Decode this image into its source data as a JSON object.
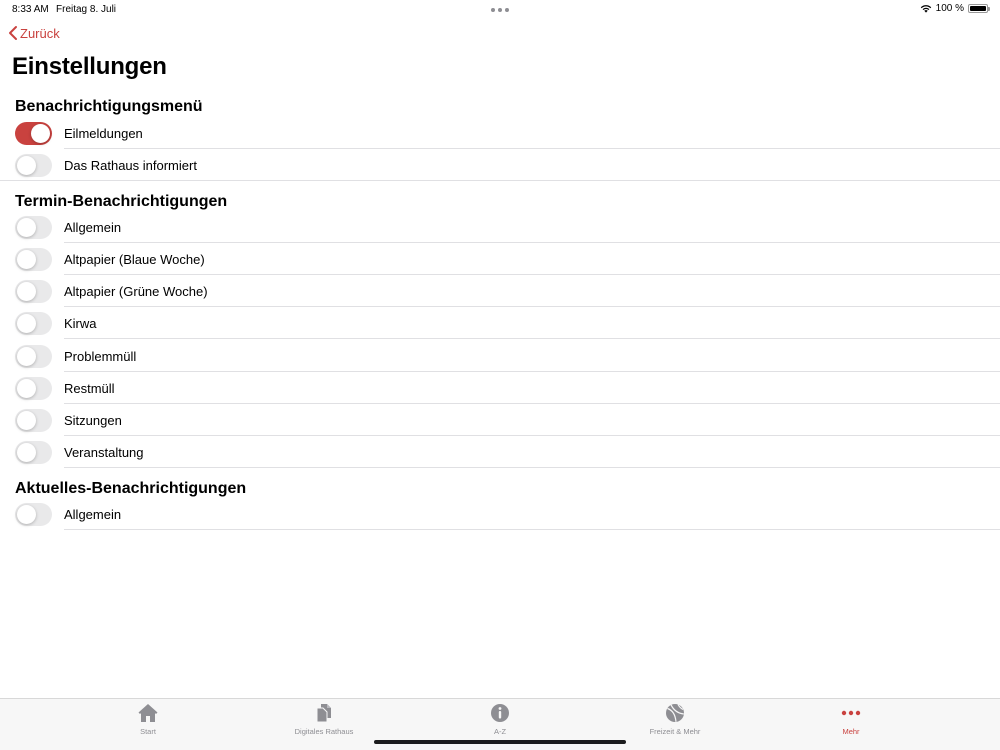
{
  "status_bar": {
    "time": "8:33 AM",
    "date": "Freitag 8. Juli",
    "battery_text": "100 %",
    "icons": [
      "wifi-icon",
      "battery-icon"
    ]
  },
  "nav": {
    "back_label": "Zurück",
    "title": "Einstellungen"
  },
  "accent_color": "#c9423f",
  "sections": [
    {
      "title": "Benachrichtigungsmenü",
      "items": [
        {
          "label": "Eilmeldungen",
          "enabled": true
        },
        {
          "label": "Das Rathaus informiert",
          "enabled": false
        }
      ]
    },
    {
      "title": "Termin-Benachrichtigungen",
      "items": [
        {
          "label": "Allgemein",
          "enabled": false
        },
        {
          "label": "Altpapier (Blaue Woche)",
          "enabled": false
        },
        {
          "label": "Altpapier (Grüne Woche)",
          "enabled": false
        },
        {
          "label": "Kirwa",
          "enabled": false
        },
        {
          "label": "Problemmüll",
          "enabled": false
        },
        {
          "label": "Restmüll",
          "enabled": false
        },
        {
          "label": "Sitzungen",
          "enabled": false
        },
        {
          "label": "Veranstaltung",
          "enabled": false
        }
      ]
    },
    {
      "title": "Aktuelles-Benachrichtigungen",
      "items": [
        {
          "label": "Allgemein",
          "enabled": false
        }
      ]
    }
  ],
  "tab_bar": {
    "tabs": [
      {
        "label": "Start",
        "icon": "house-icon",
        "active": false
      },
      {
        "label": "Digitales Rathaus",
        "icon": "documents-icon",
        "active": false
      },
      {
        "label": "A-Z",
        "icon": "info-icon",
        "active": false
      },
      {
        "label": "Freizeit & Mehr",
        "icon": "ball-icon",
        "active": false
      },
      {
        "label": "Mehr",
        "icon": "more-dots-icon",
        "active": true
      }
    ]
  }
}
